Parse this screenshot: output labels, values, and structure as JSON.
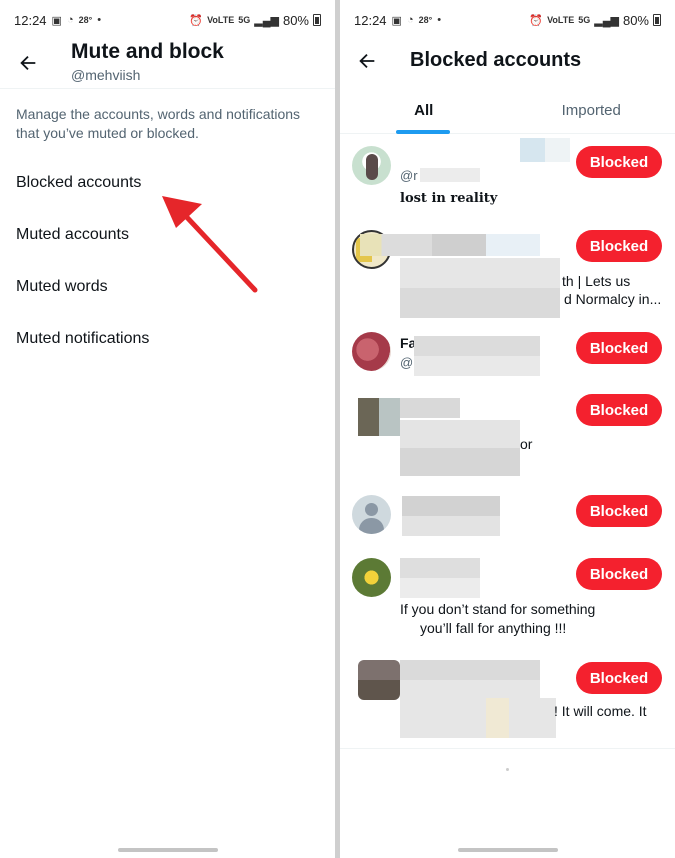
{
  "status_bar": {
    "time": "12:24",
    "temp": "28°",
    "battery": "80%",
    "net": "VoLTE",
    "net2": "5G"
  },
  "left": {
    "title": "Mute and block",
    "username": "@mehviish",
    "description": "Manage the accounts, words and notifications that you’ve muted or blocked.",
    "menu": [
      {
        "label": "Blocked accounts"
      },
      {
        "label": "Muted accounts"
      },
      {
        "label": "Muted words"
      },
      {
        "label": "Muted notifications"
      }
    ]
  },
  "right": {
    "title": "Blocked accounts",
    "tabs": [
      {
        "label": "All"
      },
      {
        "label": "Imported"
      }
    ],
    "blocked_label": "Blocked",
    "accounts": [
      {
        "handle": "@r",
        "bio": "lost in reality"
      },
      {
        "bio_1": "th | Lets us",
        "bio_2": "d Normalcy in..."
      },
      {
        "name": "Fa",
        "handle": "@"
      },
      {
        "bio": "or"
      },
      {
        "name": "",
        "handle": ""
      },
      {
        "bio_1": "If you don’t stand for something",
        "bio_2": "you’ll fall for anything !!!"
      },
      {
        "bio": "! It will come. It"
      }
    ]
  },
  "colors": {
    "accent": "#1d9bf0",
    "blocked": "#f4212e",
    "arrow": "#e5262a"
  }
}
